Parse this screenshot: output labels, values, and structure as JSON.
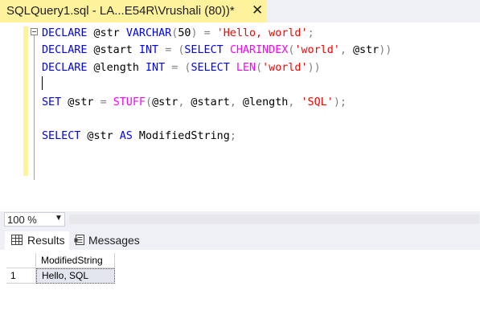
{
  "tab": {
    "title": "SQLQuery1.sql - LA...E54R\\Vrushali (80))*",
    "close_glyph": "✕"
  },
  "editor": {
    "lines": [
      [
        {
          "t": "DECLARE",
          "c": "kw"
        },
        {
          "t": " @str ",
          "c": "id"
        },
        {
          "t": "VARCHAR",
          "c": "kw"
        },
        {
          "t": "(",
          "c": "op"
        },
        {
          "t": "50",
          "c": "id"
        },
        {
          "t": ")",
          "c": "op"
        },
        {
          "t": " ",
          "c": "id"
        },
        {
          "t": "=",
          "c": "op"
        },
        {
          "t": " ",
          "c": "id"
        },
        {
          "t": "'Hello, world'",
          "c": "str"
        },
        {
          "t": ";",
          "c": "op"
        }
      ],
      [
        {
          "t": "DECLARE",
          "c": "kw"
        },
        {
          "t": " @start ",
          "c": "id"
        },
        {
          "t": "INT",
          "c": "kw"
        },
        {
          "t": " ",
          "c": "id"
        },
        {
          "t": "=",
          "c": "op"
        },
        {
          "t": " ",
          "c": "id"
        },
        {
          "t": "(",
          "c": "op"
        },
        {
          "t": "SELECT",
          "c": "kw"
        },
        {
          "t": " ",
          "c": "id"
        },
        {
          "t": "CHARINDEX",
          "c": "fn"
        },
        {
          "t": "(",
          "c": "op"
        },
        {
          "t": "'world'",
          "c": "str"
        },
        {
          "t": ",",
          "c": "op"
        },
        {
          "t": " @str",
          "c": "id"
        },
        {
          "t": "))",
          "c": "op"
        }
      ],
      [
        {
          "t": "DECLARE",
          "c": "kw"
        },
        {
          "t": " @length ",
          "c": "id"
        },
        {
          "t": "INT",
          "c": "kw"
        },
        {
          "t": " ",
          "c": "id"
        },
        {
          "t": "=",
          "c": "op"
        },
        {
          "t": " ",
          "c": "id"
        },
        {
          "t": "(",
          "c": "op"
        },
        {
          "t": "SELECT",
          "c": "kw"
        },
        {
          "t": " ",
          "c": "id"
        },
        {
          "t": "LEN",
          "c": "fn"
        },
        {
          "t": "(",
          "c": "op"
        },
        {
          "t": "'world'",
          "c": "str"
        },
        {
          "t": "))",
          "c": "op"
        }
      ],
      [
        {
          "t": "",
          "c": "caret"
        }
      ],
      [
        {
          "t": "SET",
          "c": "kw"
        },
        {
          "t": " @str ",
          "c": "id"
        },
        {
          "t": "=",
          "c": "op"
        },
        {
          "t": " ",
          "c": "id"
        },
        {
          "t": "STUFF",
          "c": "fn"
        },
        {
          "t": "(",
          "c": "op"
        },
        {
          "t": "@str",
          "c": "id"
        },
        {
          "t": ",",
          "c": "op"
        },
        {
          "t": " @start",
          "c": "id"
        },
        {
          "t": ",",
          "c": "op"
        },
        {
          "t": " @length",
          "c": "id"
        },
        {
          "t": ",",
          "c": "op"
        },
        {
          "t": " ",
          "c": "id"
        },
        {
          "t": "'SQL'",
          "c": "str"
        },
        {
          "t": ");",
          "c": "op"
        }
      ],
      [],
      [
        {
          "t": "SELECT",
          "c": "kw"
        },
        {
          "t": " @str ",
          "c": "id"
        },
        {
          "t": "AS",
          "c": "kw"
        },
        {
          "t": " ModifiedString",
          "c": "id"
        },
        {
          "t": ";",
          "c": "op"
        }
      ]
    ]
  },
  "zoom": {
    "value": "100 %",
    "arrow": "▼"
  },
  "results_tabs": [
    {
      "label": "Results",
      "icon": "grid-icon",
      "active": true
    },
    {
      "label": "Messages",
      "icon": "messages-icon",
      "active": false
    }
  ],
  "grid": {
    "columns": [
      "ModifiedString"
    ],
    "rows": [
      {
        "num": "1",
        "values": [
          "Hello, SQL"
        ]
      }
    ]
  },
  "colors": {
    "tab_active": "#fff29d",
    "keyword": "#0000ff",
    "function": "#ff00ff",
    "string": "#ff0000",
    "operator": "#808080",
    "panel_bg": "#eef0f5",
    "selected_cell": "#e2e6ef"
  }
}
